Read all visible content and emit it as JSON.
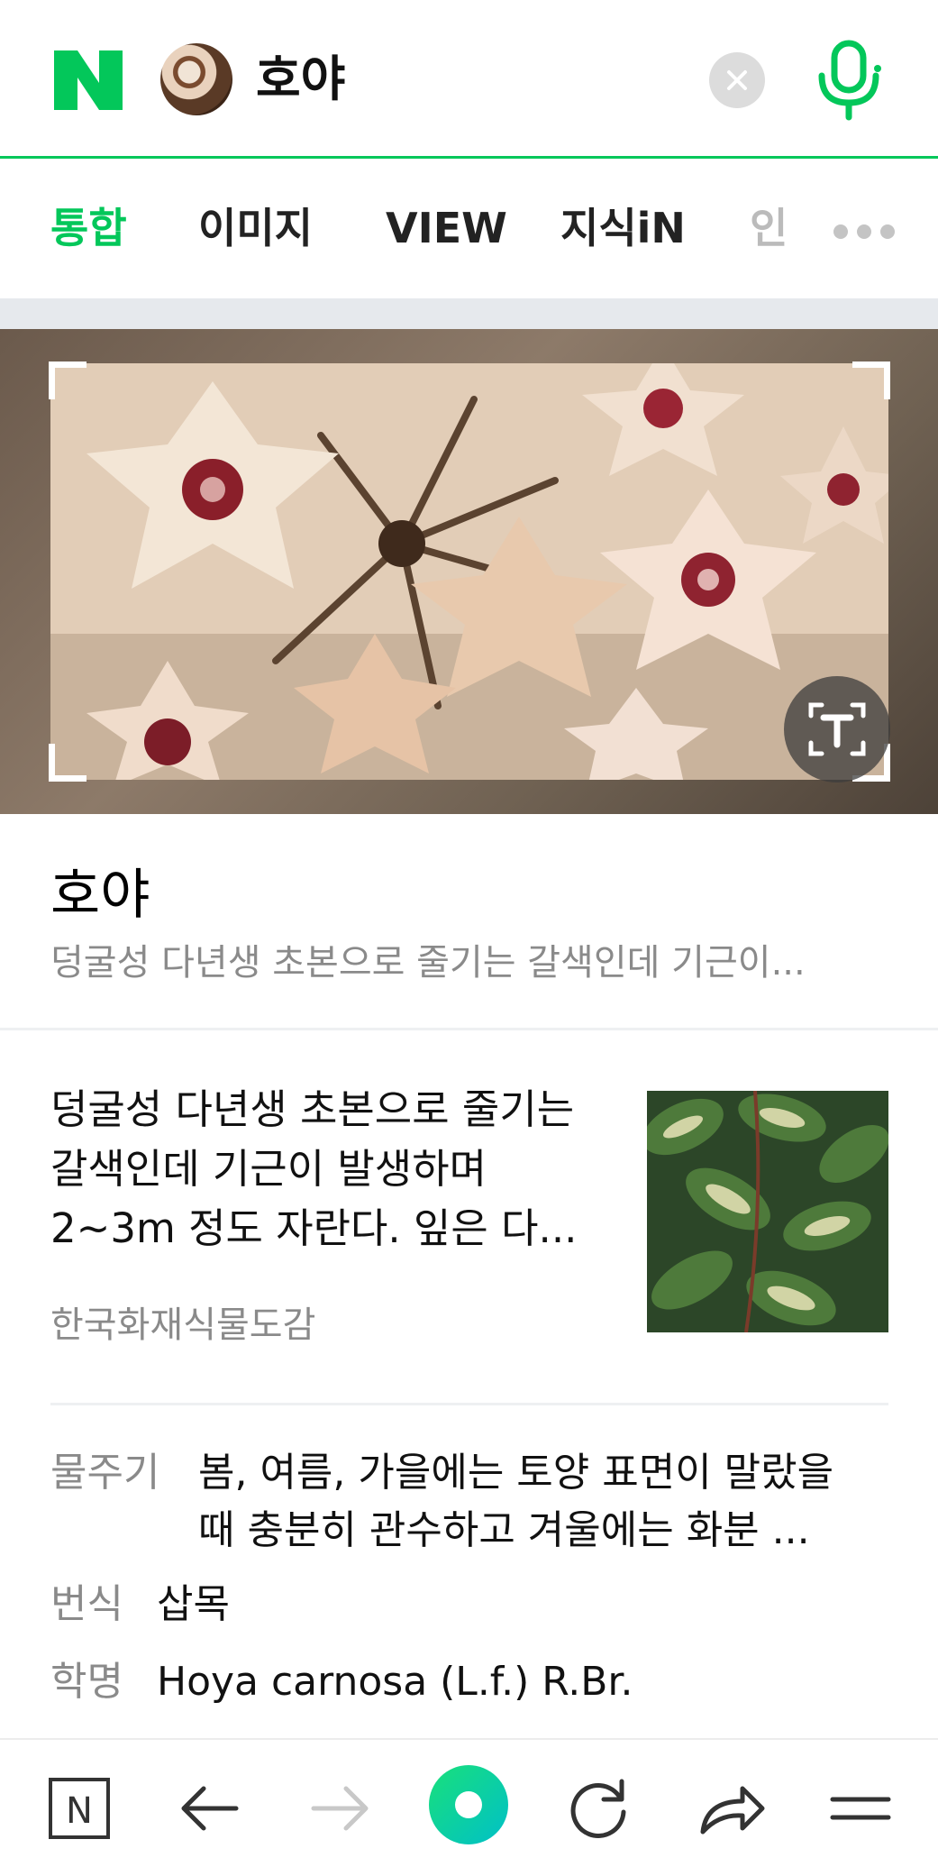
{
  "header": {
    "logo_letter": "N",
    "query": "호야",
    "brand_color": "#03c75a"
  },
  "tabs": [
    {
      "label": "통합",
      "active": true
    },
    {
      "label": "이미지",
      "active": false
    },
    {
      "label": "VIEW",
      "active": false
    },
    {
      "label": "지식iN",
      "active": false
    },
    {
      "label": "인",
      "active": false
    }
  ],
  "image_search": {
    "ocr_button_icon": "text-recognition-icon"
  },
  "result": {
    "title": "호야",
    "summary": "덩굴성 다년생 초본으로 줄기는 갈색인데 기근이...",
    "description": "덩굴성 다년생 초본으로 줄기는 갈색인데 기근이 발생하며 2~3m 정도 자란다. 잎은 다...",
    "source": "한국화재식물도감"
  },
  "info": {
    "watering_label": "물주기",
    "watering_value_line1": "봄, 여름, 가을에는 토양 표면이 말랐을",
    "watering_value_line2": "때 충분히 관수하고 겨울에는 화분 ...",
    "propagation_label": "번식",
    "propagation_value": "삽목",
    "scientific_label": "학명",
    "scientific_value": "Hoya carnosa (L.f.) R.Br."
  },
  "bottom_nav": {
    "home_letter": "N"
  }
}
